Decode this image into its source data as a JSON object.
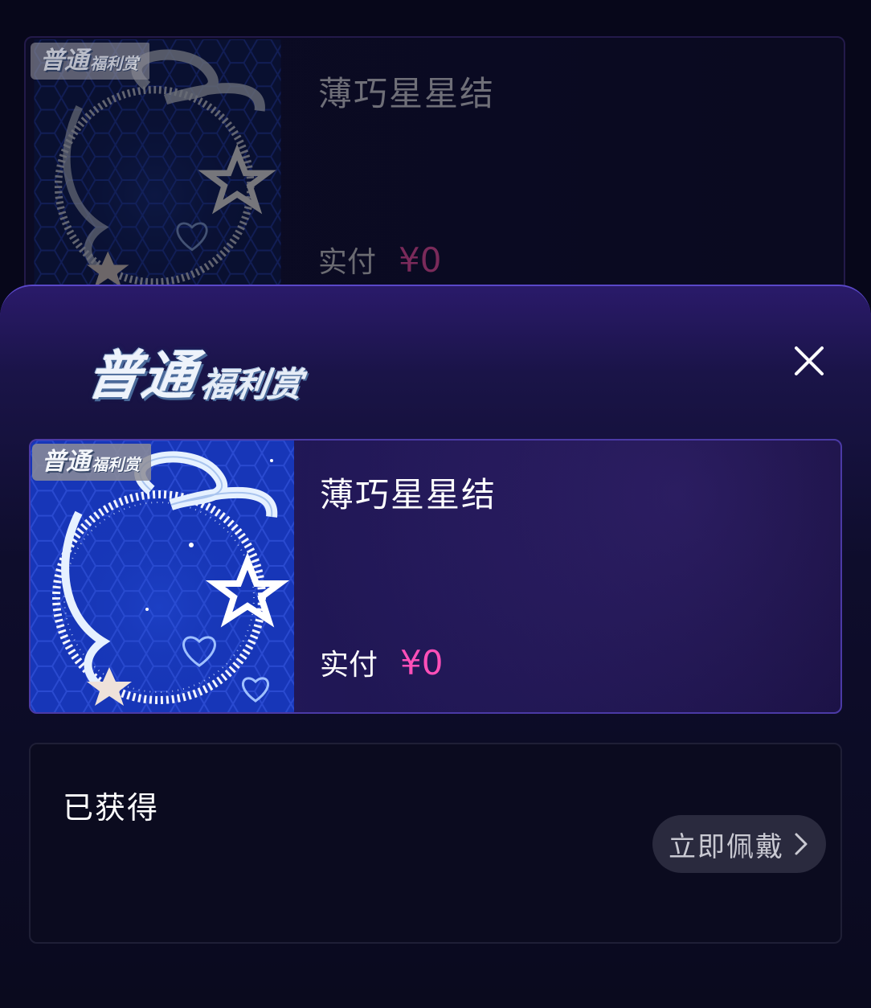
{
  "background_card": {
    "badge_main": "普通",
    "badge_sub": "福利赏",
    "title": "薄巧星星结",
    "price_label": "实付",
    "price_value": "¥0"
  },
  "sheet": {
    "badge_main": "普通",
    "badge_sub": "福利赏",
    "close_icon": "close-icon",
    "item": {
      "badge_main": "普通",
      "badge_sub": "福利赏",
      "title": "薄巧星星结",
      "price_label": "实付",
      "price_value": "¥0"
    },
    "obtained": {
      "label": "已获得",
      "wear_button": "立即佩戴",
      "wear_icon": "chevron-right-icon"
    }
  },
  "colors": {
    "price_accent": "#ff4fb8",
    "sheet_top": "#2a1a6a",
    "page_bg": "#07071a"
  }
}
